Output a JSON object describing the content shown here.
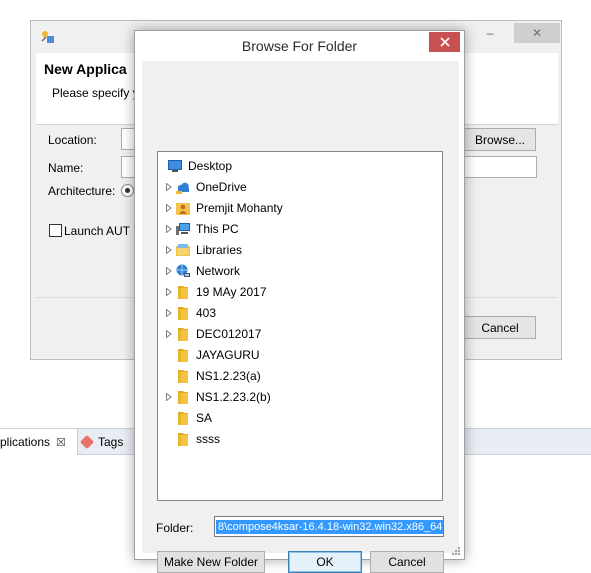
{
  "bg_window": {
    "header_title": "New Applica",
    "header_subtitle": "Please specify y",
    "location_label": "Location:",
    "name_label": "Name:",
    "architecture_label": "Architecture:",
    "browse_label": "Browse...",
    "launch_label": "Launch AUT",
    "cancel_label": "Cancel",
    "close_glyph": "✕",
    "minimize_glyph": "–"
  },
  "tabs": {
    "applications_label": "plications",
    "applications_close": "☒",
    "tags_label": "Tags"
  },
  "dialog": {
    "title": "Browse For Folder",
    "tree": [
      {
        "label": "Desktop",
        "icon": "desktop-icon",
        "expandable": false
      },
      {
        "label": "OneDrive",
        "icon": "cloud-icon",
        "expandable": true
      },
      {
        "label": "Premjit Mohanty",
        "icon": "user-folder-icon",
        "expandable": true
      },
      {
        "label": "This PC",
        "icon": "computer-icon",
        "expandable": true
      },
      {
        "label": "Libraries",
        "icon": "libraries-icon",
        "expandable": true
      },
      {
        "label": "Network",
        "icon": "network-icon",
        "expandable": true
      },
      {
        "label": "19 MAy 2017",
        "icon": "folder-icon",
        "expandable": true
      },
      {
        "label": "403",
        "icon": "folder-icon",
        "expandable": true
      },
      {
        "label": "DEC012017",
        "icon": "folder-icon",
        "expandable": true
      },
      {
        "label": "JAYAGURU",
        "icon": "folder-icon",
        "expandable": false
      },
      {
        "label": "NS1.2.23(a)",
        "icon": "folder-icon",
        "expandable": false
      },
      {
        "label": "NS1.2.23.2(b)",
        "icon": "folder-icon",
        "expandable": true
      },
      {
        "label": "SA",
        "icon": "folder-icon",
        "expandable": false
      },
      {
        "label": "ssss",
        "icon": "folder-icon",
        "expandable": false
      }
    ],
    "folder_label": "Folder:",
    "folder_value": "8\\compose4ksar-16.4.18-win32.win32.x86_64",
    "make_new_folder_label": "Make New Folder",
    "ok_label": "OK",
    "cancel_label": "Cancel"
  },
  "colors": {
    "close_button": "#c75050",
    "selection": "#3399ff",
    "folder": "#f5c342"
  }
}
